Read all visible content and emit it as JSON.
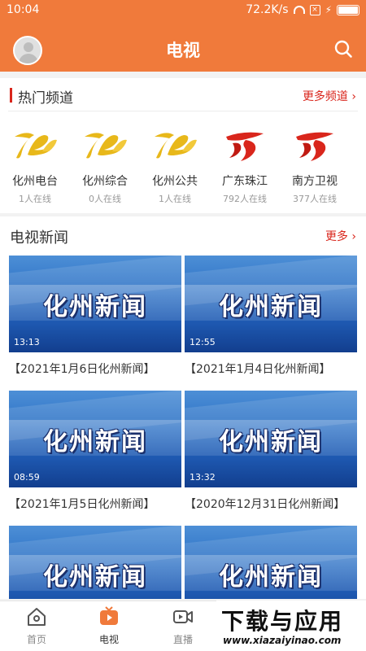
{
  "status_bar": {
    "time": "10:04",
    "speed": "72.2K/s"
  },
  "header": {
    "title": "电视"
  },
  "hot_channels": {
    "title": "热门频道",
    "more": "更多频道 ›",
    "items": [
      {
        "name": "化州电台",
        "online": "1人在线",
        "logo": "huazhou-logo"
      },
      {
        "name": "化州综合",
        "online": "0人在线",
        "logo": "huazhou-logo"
      },
      {
        "name": "化州公共",
        "online": "1人在线",
        "logo": "huazhou-logo"
      },
      {
        "name": "广东珠江",
        "online": "792人在线",
        "logo": "gdtv-logo"
      },
      {
        "name": "南方卫视",
        "online": "377人在线",
        "logo": "gdtv-logo"
      }
    ]
  },
  "news": {
    "title": "电视新闻",
    "more": "更多 ›",
    "thumb_text": "化州新闻",
    "items": [
      {
        "duration": "13:13",
        "caption": "【2021年1月6日化州新闻】"
      },
      {
        "duration": "12:55",
        "caption": "【2021年1月4日化州新闻】"
      },
      {
        "duration": "08:59",
        "caption": "【2021年1月5日化州新闻】"
      },
      {
        "duration": "13:32",
        "caption": "【2020年12月31日化州新闻】"
      },
      {
        "duration": "",
        "caption": ""
      },
      {
        "duration": "",
        "caption": ""
      }
    ]
  },
  "bottom_nav": [
    {
      "label": "首页",
      "icon": "home-icon"
    },
    {
      "label": "电视",
      "icon": "tv-icon"
    },
    {
      "label": "直播",
      "icon": "video-icon"
    }
  ],
  "watermark": {
    "big": "下载与应用",
    "small": "www.xiazaiyinao.com"
  },
  "colors": {
    "accent": "#f07a3b",
    "red": "#d9261c",
    "logo_gold": "#e8b81a"
  }
}
